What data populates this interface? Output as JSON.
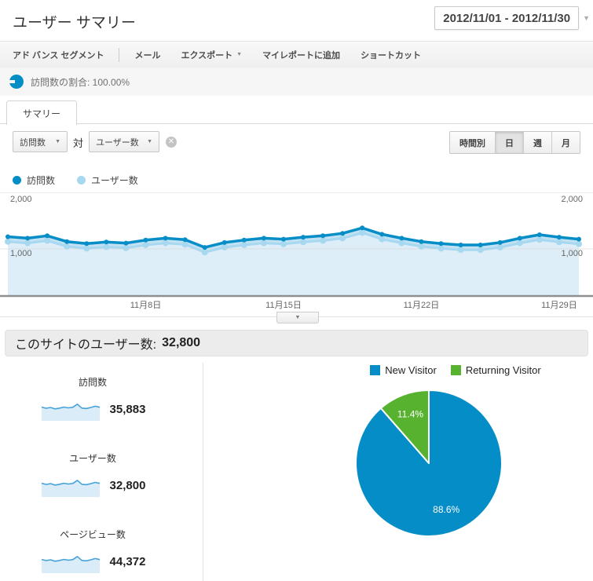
{
  "colors": {
    "accent_blue": "#058dc7",
    "light_blue": "#a7d8f0",
    "green": "#57b32f"
  },
  "header": {
    "title": "ユーザー サマリー",
    "date_range": "2012/11/01 - 2012/11/30"
  },
  "toolbar": {
    "items": [
      {
        "label": "アド バンス セグメント"
      },
      {
        "label": "メール"
      },
      {
        "label": "エクスポート"
      },
      {
        "label": "マイレポートに追加"
      },
      {
        "label": "ショートカット"
      }
    ]
  },
  "segment": {
    "label": "訪問数の割合: 100.00%"
  },
  "tabs": [
    {
      "label": "サマリー"
    }
  ],
  "controls": {
    "metric_select": "訪問数",
    "vs_label": "対",
    "compare_select": "ユーザー数",
    "granularity": [
      {
        "label": "時間別",
        "active": false
      },
      {
        "label": "日",
        "active": true
      },
      {
        "label": "週",
        "active": false
      },
      {
        "label": "月",
        "active": false
      }
    ]
  },
  "legend": [
    {
      "label": "訪問数",
      "color": "#058dc7"
    },
    {
      "label": "ユーザー数",
      "color": "#a7d8f0"
    }
  ],
  "summary": {
    "label": "このサイトのユーザー数:",
    "value": "32,800"
  },
  "metrics": [
    {
      "label": "訪問数",
      "value": "35,883",
      "spark": [
        5.2,
        4.6,
        5.0,
        4.3,
        4.7,
        5.2,
        4.8,
        5.1,
        6.6,
        4.7,
        4.5,
        5.0,
        5.6,
        5.1
      ]
    },
    {
      "label": "ユーザー数",
      "value": "32,800",
      "spark": [
        5.2,
        4.6,
        5.0,
        4.3,
        4.7,
        5.2,
        4.8,
        5.1,
        6.6,
        4.7,
        4.5,
        5.0,
        5.6,
        5.1
      ]
    },
    {
      "label": "ページビュー数",
      "value": "44,372",
      "spark": [
        5.2,
        4.6,
        5.0,
        4.3,
        4.7,
        5.2,
        4.8,
        5.1,
        6.6,
        4.7,
        4.5,
        5.0,
        5.6,
        5.1
      ]
    }
  ],
  "chart_data": [
    {
      "type": "area",
      "x_days": [
        1,
        2,
        3,
        4,
        5,
        6,
        7,
        8,
        9,
        10,
        11,
        12,
        13,
        14,
        15,
        16,
        17,
        18,
        19,
        20,
        21,
        22,
        23,
        24,
        25,
        26,
        27,
        28,
        29,
        30
      ],
      "x_ticks": [
        {
          "day": 8,
          "label": "11月8日"
        },
        {
          "day": 15,
          "label": "11月15日"
        },
        {
          "day": 22,
          "label": "11月22日"
        },
        {
          "day": 29,
          "label": "11月29日"
        }
      ],
      "y_ticks": [
        {
          "value": 1000,
          "label": "1,000"
        },
        {
          "value": 2000,
          "label": "2,000"
        }
      ],
      "ylim": [
        0,
        2000
      ],
      "grid": "horizontal",
      "legend_position": "top-left",
      "series": [
        {
          "name": "訪問数",
          "color": "#058dc7",
          "values": [
            1250,
            1220,
            1270,
            1150,
            1110,
            1140,
            1120,
            1180,
            1220,
            1190,
            1030,
            1130,
            1180,
            1220,
            1200,
            1240,
            1270,
            1320,
            1430,
            1300,
            1220,
            1150,
            1110,
            1080,
            1080,
            1130,
            1220,
            1290,
            1240,
            1200
          ]
        },
        {
          "name": "ユーザー数",
          "color": "#a7d8f0",
          "values": [
            1150,
            1120,
            1170,
            1050,
            1010,
            1040,
            1020,
            1080,
            1120,
            1090,
            930,
            1030,
            1080,
            1120,
            1100,
            1140,
            1170,
            1220,
            1330,
            1200,
            1120,
            1050,
            1010,
            980,
            980,
            1030,
            1120,
            1190,
            1140,
            1100
          ]
        }
      ]
    },
    {
      "type": "pie",
      "labels": [
        "New Visitor",
        "Returning Visitor"
      ],
      "values": [
        88.6,
        11.4
      ],
      "value_labels": [
        "88.6%",
        "11.4%"
      ],
      "colors": [
        "#058dc7",
        "#57b32f"
      ],
      "legend_position": "top"
    }
  ]
}
